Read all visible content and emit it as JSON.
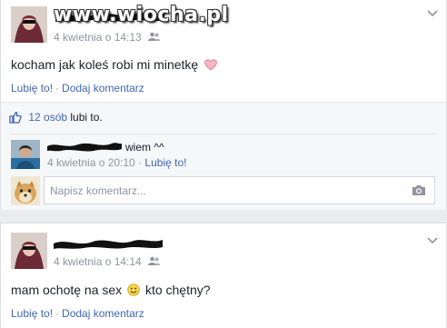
{
  "watermark": "www.wiocha.pl",
  "posts": [
    {
      "timestamp": "4 kwietnia o 14:13",
      "text_before": "kocham jak koleś robi mi minetkę",
      "text_after": "",
      "emoji": "heart-icon",
      "like_label": "Lubię to!",
      "separator": "·",
      "comment_label": "Dodaj komentarz",
      "likes": {
        "count": "12 osób",
        "suffix": "lubi to."
      },
      "comment": {
        "text": "wiem ^^",
        "timestamp": "4 kwietnia o 20:10",
        "separator": "·",
        "like_label": "Lubię to!"
      },
      "composer_placeholder": "Napisz komentarz..."
    },
    {
      "timestamp": "4 kwietnia o 14:14",
      "text_before": "mam ochotę na sex",
      "text_after": "kto chętny?",
      "emoji": "smiley-icon",
      "like_label": "Lubię to!",
      "separator": "·",
      "comment_label": "Dodaj komentarz"
    }
  ],
  "colors": {
    "link": "#4267b2",
    "meta": "#90949c",
    "background": "#e9ebee",
    "card": "#ffffff",
    "ufi": "#f6f7f9"
  }
}
